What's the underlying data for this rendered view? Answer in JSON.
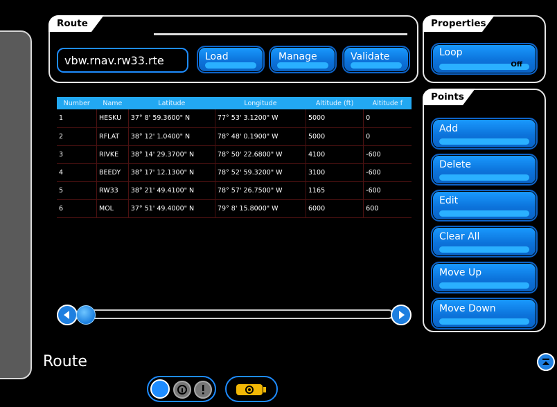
{
  "panels": {
    "route_tab": "Route",
    "properties_tab": "Properties",
    "points_tab": "Points"
  },
  "route": {
    "file_name": "vbw.rnav.rw33.rte",
    "load_label": "Load",
    "manage_label": "Manage",
    "validate_label": "Validate"
  },
  "properties": {
    "loop_label": "Loop",
    "loop_value": "Off"
  },
  "points_buttons": {
    "add": "Add",
    "delete": "Delete",
    "edit": "Edit",
    "clear_all": "Clear All",
    "move_up": "Move Up",
    "move_down": "Move Down"
  },
  "table": {
    "headers": [
      "Number",
      "Name",
      "Latitude",
      "Longitude",
      "Altitude (ft)",
      "Altitude f"
    ],
    "rows": [
      [
        "1",
        "HESKU",
        "37° 8' 59.3600\" N",
        "77° 53' 3.1200\" W",
        "5000",
        "0"
      ],
      [
        "2",
        "RFLAT",
        "38° 12' 1.0400\" N",
        "78° 48' 0.1900\" W",
        "5000",
        "0"
      ],
      [
        "3",
        "RIVKE",
        "38° 14' 29.3700\" N",
        "78° 50' 22.6800\" W",
        "4100",
        "-600"
      ],
      [
        "4",
        "BEEDY",
        "38° 17' 12.1300\" N",
        "78° 52' 59.3200\" W",
        "3100",
        "-600"
      ],
      [
        "5",
        "RW33",
        "38° 21' 49.4100\" N",
        "78° 57' 26.7500\" W",
        "1165",
        "-600"
      ],
      [
        "6",
        "MOL",
        "37° 51' 49.4000\" N",
        "79° 8' 15.8000\" W",
        "6000",
        "600"
      ]
    ]
  },
  "footer": {
    "title": "Route"
  },
  "colors": {
    "accent_blue": "#1a8cff",
    "header_blue": "#22a8f2",
    "battery_yellow": "#f2b705"
  }
}
